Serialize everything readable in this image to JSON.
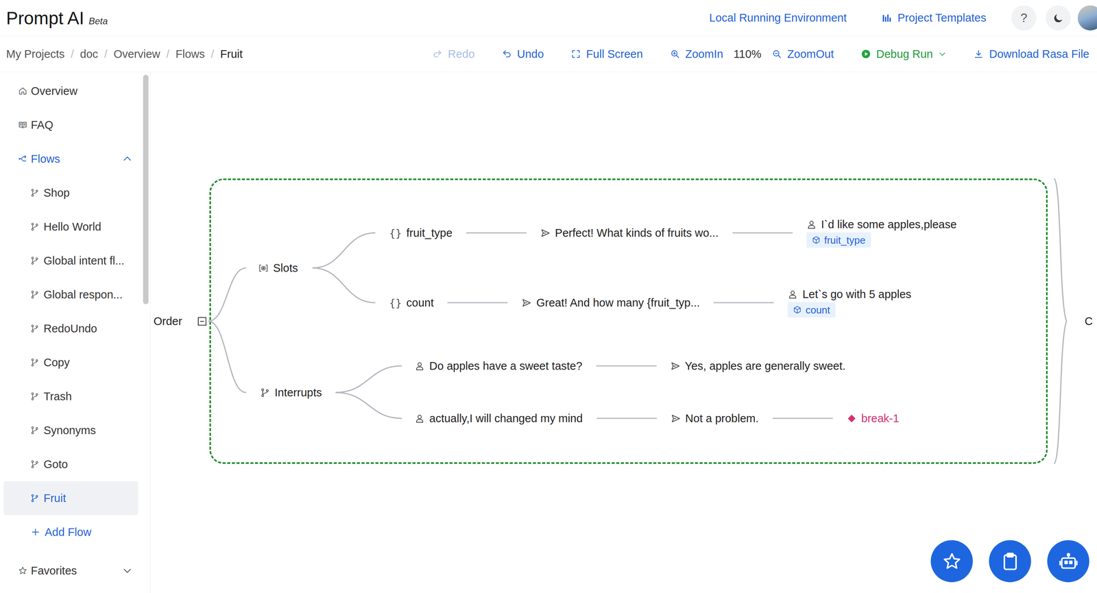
{
  "app": {
    "name": "Prompt AI",
    "badge": "Beta"
  },
  "header": {
    "links": [
      "Local Running Environment",
      "Project Templates"
    ],
    "help": "?"
  },
  "breadcrumb": {
    "separator": "/",
    "items": [
      "My Projects",
      "doc",
      "Overview",
      "Flows",
      "Fruit"
    ]
  },
  "toolbar": [
    {
      "label": "Redo",
      "kind": "button",
      "disabled": true
    },
    {
      "label": "Undo",
      "kind": "button",
      "disabled": false
    },
    {
      "label": "Full Screen",
      "kind": "button",
      "disabled": false
    },
    {
      "label": "ZoomIn",
      "kind": "button",
      "disabled": false
    },
    {
      "label": "110%",
      "kind": "reading",
      "disabled": false
    },
    {
      "label": "ZoomOut",
      "kind": "button",
      "disabled": false
    },
    {
      "label": "Debug Run",
      "kind": "run",
      "disabled": false
    },
    {
      "label": "Download Rasa File",
      "kind": "button",
      "disabled": false
    }
  ],
  "sidebar": {
    "items": [
      {
        "label": "Overview",
        "kind": "page",
        "selected": false
      },
      {
        "label": "FAQ",
        "kind": "page",
        "selected": false
      },
      {
        "label": "Flows",
        "kind": "group",
        "selected": false,
        "expanded": true
      },
      {
        "label": "Shop",
        "kind": "flow",
        "selected": false
      },
      {
        "label": "Hello World",
        "kind": "flow",
        "selected": false
      },
      {
        "label": "Global intent fl...",
        "kind": "flow",
        "selected": false
      },
      {
        "label": "Global respon...",
        "kind": "flow",
        "selected": false
      },
      {
        "label": "RedoUndo",
        "kind": "flow",
        "selected": false
      },
      {
        "label": "Copy",
        "kind": "flow",
        "selected": false
      },
      {
        "label": "Trash",
        "kind": "flow",
        "selected": false
      },
      {
        "label": "Synonyms",
        "kind": "flow",
        "selected": false
      },
      {
        "label": "Goto",
        "kind": "flow",
        "selected": false
      },
      {
        "label": "Fruit",
        "kind": "flow",
        "selected": true
      },
      {
        "label": "Add Flow",
        "kind": "add",
        "selected": false
      },
      {
        "label": "Favorites",
        "kind": "group",
        "selected": false,
        "expanded": false
      }
    ]
  },
  "diagram": {
    "root": {
      "label": "Order",
      "expanded": true
    },
    "slots": {
      "label": "Slots",
      "items": [
        {
          "mark": "{}",
          "name": "fruit_type",
          "bot": "Perfect! What kinds of fruits wo...",
          "user": "I`d like some apples,please",
          "tag": "fruit_type"
        },
        {
          "mark": "{}",
          "name": "count",
          "bot": "Great! And how many {fruit_typ...",
          "user": "Let`s go with 5 apples",
          "tag": "count"
        }
      ]
    },
    "interrupts": {
      "label": "Interrupts",
      "items": [
        {
          "user": "Do apples have a sweet taste?",
          "bot": "Yes, apples are generally sweet.",
          "action": null
        },
        {
          "user": "actually,I will changed my mind",
          "bot": "Not a problem.",
          "action": "break-1"
        }
      ]
    },
    "next": {
      "label": "C"
    }
  }
}
